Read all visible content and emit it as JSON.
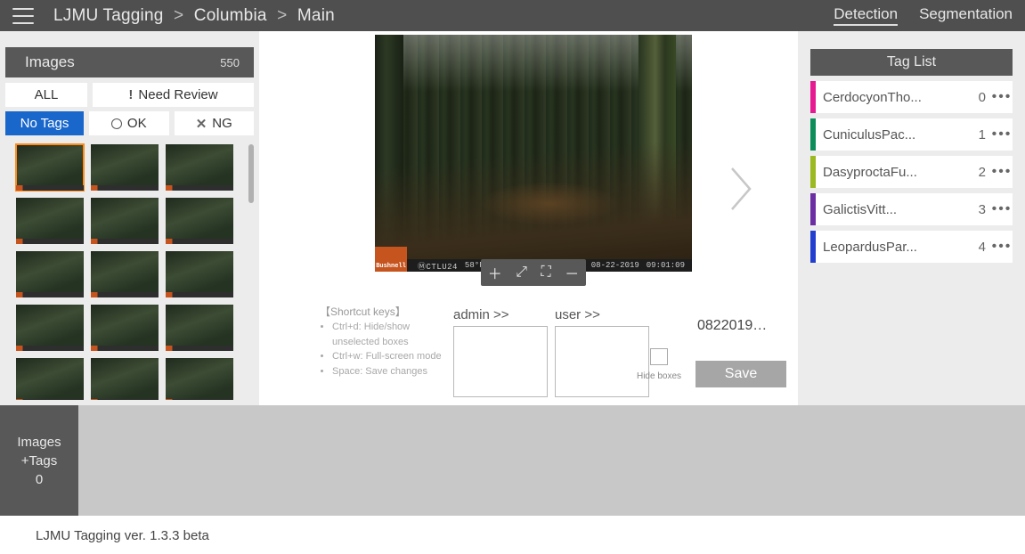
{
  "breadcrumb": {
    "app": "LJMU Tagging",
    "p1": "Columbia",
    "p2": "Main"
  },
  "nav": {
    "detection": "Detection",
    "segmentation": "Segmentation"
  },
  "images": {
    "title": "Images",
    "count": "550",
    "filters": {
      "all": "ALL",
      "need": "Need Review",
      "notags": "No Tags",
      "ok": "OK",
      "ng": "NG"
    }
  },
  "viewer": {
    "camera": "CTLU24",
    "temp": "58°F 25°C",
    "date": "08-22-2019",
    "time": "09:01:09",
    "brand": "Bushnell"
  },
  "hints": {
    "title": "【Shortcut keys】",
    "k1": "Ctrl+d: Hide/show unselected boxes",
    "k2": "Ctrl+w: Full-screen mode",
    "k3": "Space: Save changes"
  },
  "ann": {
    "admin": "admin >>",
    "user": "user >>",
    "hide": "Hide boxes",
    "file": "0822019…",
    "save": "Save"
  },
  "tags": {
    "title": "Tag List",
    "items": [
      {
        "name": "CerdocyonTho...",
        "key": "0",
        "color": "#e61a91"
      },
      {
        "name": "CuniculusPac...",
        "key": "1",
        "color": "#0c8d5a"
      },
      {
        "name": "DasyproctaFu...",
        "key": "2",
        "color": "#9bb921"
      },
      {
        "name": "GalictisVitt...",
        "key": "3",
        "color": "#6c2ea3"
      },
      {
        "name": "LeopardusPar...",
        "key": "4",
        "color": "#233fd0"
      }
    ]
  },
  "bottom": {
    "l1": "Images",
    "l2": "+Tags",
    "l3": "0"
  },
  "footer": "LJMU Tagging ver. 1.3.3 beta"
}
